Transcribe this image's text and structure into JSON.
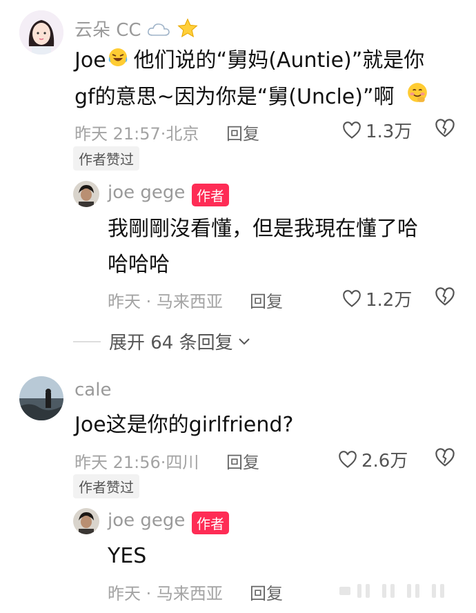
{
  "comments": [
    {
      "username": "云朵 CC",
      "username_emoji": [
        "cloud-icon",
        "star-icon"
      ],
      "text_line1": "他们说的“舅妈(Auntie)”就是你",
      "text_prefix": "Joe",
      "text_line2": "gf的意思~因为你是“舅(Uncle)”啊",
      "time": "昨天 21:57·",
      "location": "北京",
      "reply_label": "回复",
      "likes": "1.3万",
      "tag": "作者赞过",
      "reply": {
        "username": "joe gege",
        "badge": "作者",
        "text_line1": "我剛剛沒看懂，但是我現在懂了哈",
        "text_line2": "哈哈哈",
        "time": "昨天 · 马来西亚",
        "reply_label": "回复",
        "likes": "1.2万"
      },
      "expand_label": "展开 64 条回复"
    },
    {
      "username": "cale",
      "text": "Joe这是你的girlfriend?",
      "time": "昨天 21:56·",
      "location": "四川",
      "reply_label": "回复",
      "likes": "2.6万",
      "tag": "作者赞过",
      "reply": {
        "username": "joe gege",
        "badge": "作者",
        "text": "YES",
        "time": "昨天 · 马来西亚",
        "reply_label": "回复"
      }
    }
  ],
  "colors": {
    "accent": "#fe2c55",
    "meta": "#a3a3a3",
    "tag_bg": "#f2f2f2"
  }
}
